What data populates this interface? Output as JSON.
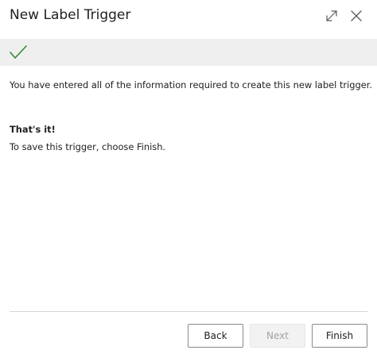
{
  "window": {
    "title": "New Label Trigger",
    "expand_icon": "expand-icon",
    "close_icon": "close-icon"
  },
  "status": {
    "icon": "checkmark-icon",
    "color": "#2e8b2e"
  },
  "content": {
    "message": "You have entered all of the information required to create this new label trigger.",
    "heading": "That's it!",
    "instruction": "To save this trigger, choose Finish."
  },
  "footer": {
    "back_label": "Back",
    "next_label": "Next",
    "finish_label": "Finish"
  }
}
